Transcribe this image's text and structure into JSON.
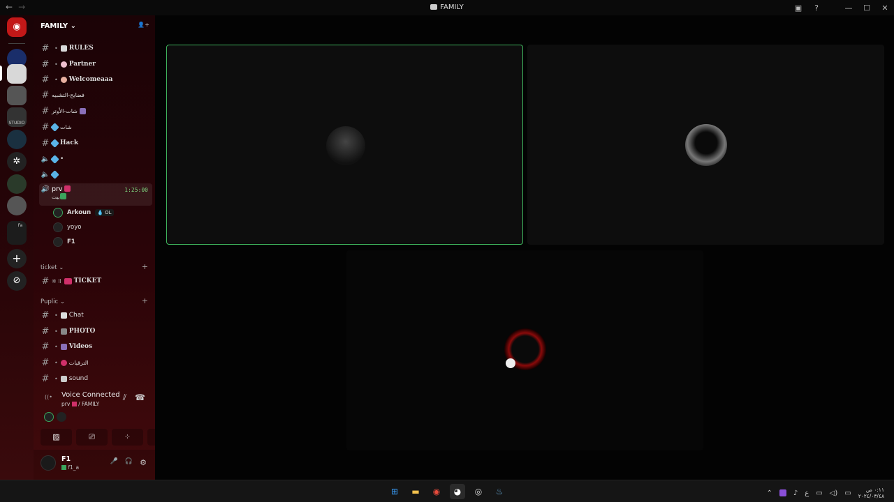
{
  "window": {
    "title": "FAMILY",
    "nav_back": "←",
    "nav_forward": "→",
    "controls": {
      "inbox": "▣",
      "help": "?",
      "minimize": "—",
      "maximize": "☐",
      "close": "✕"
    }
  },
  "server": {
    "name": "FAMILY",
    "chevron": "⌄",
    "invite_icon": "👤+"
  },
  "channels_top": [
    {
      "type": "text",
      "label": "RULES",
      "emoji_color": "#d8d8d8",
      "dot": true,
      "serif": true
    },
    {
      "type": "text",
      "label": "Partner",
      "emoji_color": "#f0c0d0",
      "dot": true,
      "serif": true
    },
    {
      "type": "text",
      "label": "Welcomeaaa",
      "emoji_color": "#e8b0a0",
      "dot": true,
      "serif": true
    },
    {
      "type": "text",
      "label": "فضايح-التشبيه",
      "serif": false
    },
    {
      "type": "text",
      "label": "شات-الأوتر",
      "serif": false
    },
    {
      "type": "text",
      "label": "شات",
      "emoji_color": "#5ab4e8",
      "serif": false
    },
    {
      "type": "text",
      "label": "Hack",
      "emoji_color": "#5ab4e8",
      "serif": true
    },
    {
      "type": "voice",
      "label": "•",
      "emoji_color": "#5ab4e8"
    },
    {
      "type": "voice",
      "label": "",
      "emoji_color": "#5ab4e8"
    }
  ],
  "active_voice": {
    "label": "prv",
    "sub": "بيت",
    "timer": "1:25:00",
    "users": [
      {
        "name": "Arkoun",
        "badge": "OL",
        "speaking": true
      },
      {
        "name": "yoyo",
        "speaking": false
      },
      {
        "name": "F1",
        "speaking": false
      }
    ]
  },
  "categories": {
    "ticket": {
      "label": "ticket",
      "chevron": "⌄",
      "add": "+",
      "channels": [
        {
          "label": "TICKET",
          "prefix": "※ ll"
        }
      ]
    },
    "puplic": {
      "label": "Puplic",
      "chevron": "⌄",
      "add": "+",
      "channels": [
        {
          "label": "Chat",
          "serif": false
        },
        {
          "label": "PHOTO",
          "serif": true
        },
        {
          "label": "Videos",
          "serif": true
        },
        {
          "label": "الترقيات",
          "serif": false
        },
        {
          "label": "sound",
          "serif": false
        }
      ]
    }
  },
  "voice_panel": {
    "title": "Voice Connected",
    "subtitle": "prv",
    "subtitle_server": "/ FAMILY",
    "signal_icon": "((•",
    "noise_icon": "⫽",
    "disconnect_icon": "☎",
    "buttons": [
      "camera-off",
      "screen-share",
      "activities",
      "soundboard"
    ]
  },
  "user_panel": {
    "name": "F1",
    "status": "f1_a",
    "mic_icon": "🎤",
    "headset_icon": "🎧",
    "settings_icon": "⚙"
  },
  "guild_icons": [
    "discord-home",
    "server-blue",
    "server-laptop",
    "server-figure",
    "server-studio",
    "server-triangle",
    "server-gear",
    "server-globe",
    "server-eye",
    "server-folder",
    "add-server",
    "explore"
  ],
  "guild_studio_label": "STUDIO",
  "guild_folder_label": "Fa",
  "taskbar": {
    "apps": [
      "windows-start",
      "file-explorer",
      "chrome",
      "discord",
      "obs",
      "steam"
    ],
    "clock_time": "٠:١١ ص",
    "clock_date": "٢٠٢٤/٠٣/٤٨",
    "lang": "ع",
    "tray_chevron": "⌃"
  }
}
